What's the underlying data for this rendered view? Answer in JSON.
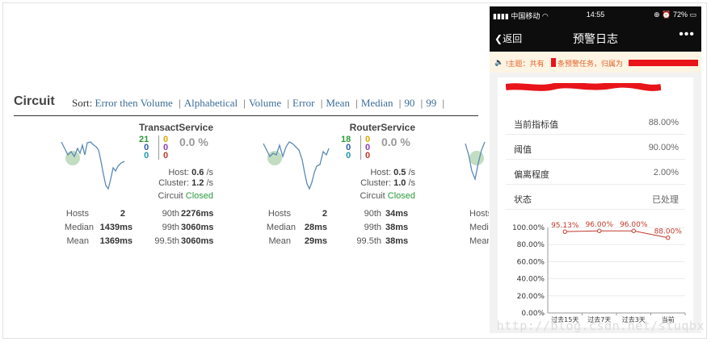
{
  "dashboard": {
    "title": "Circuit",
    "sort_label": "Sort:",
    "sort_options": [
      "Error then Volume",
      "Alphabetical",
      "Volume",
      "Error",
      "Mean",
      "Median",
      "90",
      "99"
    ],
    "cards": [
      {
        "name": "TransactService",
        "counts_left": [
          "21",
          "0",
          "0"
        ],
        "counts_right": [
          "0",
          "0",
          "0"
        ],
        "error_pct": "0.0 %",
        "host_label": "Host:",
        "host_rate": "0.6",
        "host_unit": "/s",
        "cluster_label": "Cluster:",
        "cluster_rate": "1.2",
        "cluster_unit": "/s",
        "circuit_label": "Circuit",
        "circuit_state": "Closed",
        "stats_left": [
          {
            "label": "Hosts",
            "value": "2"
          },
          {
            "label": "Median",
            "value": "1439ms"
          },
          {
            "label": "Mean",
            "value": "1369ms"
          }
        ],
        "stats_right": [
          {
            "label": "90th",
            "value": "2276ms"
          },
          {
            "label": "99th",
            "value": "3060ms"
          },
          {
            "label": "99.5th",
            "value": "3060ms"
          }
        ]
      },
      {
        "name": "RouterService",
        "counts_left": [
          "18",
          "0",
          "0"
        ],
        "counts_right": [
          "0",
          "0",
          "0"
        ],
        "error_pct": "0.0 %",
        "host_label": "Host:",
        "host_rate": "0.5",
        "host_unit": "/s",
        "cluster_label": "Cluster:",
        "cluster_rate": "1.0",
        "cluster_unit": "/s",
        "circuit_label": "Circuit",
        "circuit_state": "Closed",
        "stats_left": [
          {
            "label": "Hosts",
            "value": "2"
          },
          {
            "label": "Median",
            "value": "28ms"
          },
          {
            "label": "Mean",
            "value": "29ms"
          }
        ],
        "stats_right": [
          {
            "label": "90th",
            "value": "34ms"
          },
          {
            "label": "99th",
            "value": "38ms"
          },
          {
            "label": "99.5th",
            "value": "38ms"
          }
        ]
      },
      {
        "name": "",
        "stats_left": [
          {
            "label": "Hosts",
            "value": ""
          },
          {
            "label": "Median",
            "value": ""
          },
          {
            "label": "Mean",
            "value": ""
          }
        ]
      }
    ]
  },
  "phone": {
    "status": {
      "carrier": "中国移动",
      "time": "14:55",
      "battery": "72%"
    },
    "nav": {
      "back": "返回",
      "title": "预警日志",
      "more": "•••"
    },
    "notice": {
      "prefix": "!主题：共有",
      "middle": "条预警任务，归属为"
    },
    "metrics": [
      {
        "label": "当前指标值",
        "value": "88.00%"
      },
      {
        "label": "阈值",
        "value": "90.00%"
      },
      {
        "label": "偏离程度",
        "value": "2.00%"
      },
      {
        "label": "状态",
        "value": "已处理"
      }
    ],
    "chart_data": {
      "type": "line",
      "categories": [
        "过去15天",
        "过去7天",
        "过去3天",
        "当前"
      ],
      "values": [
        95.13,
        96.0,
        96.0,
        88.0
      ],
      "data_labels": [
        "95.13%",
        "96.00%",
        "96.00%",
        "88.00%"
      ],
      "y_ticks": [
        "0.00%",
        "20.00%",
        "40.00%",
        "60.00%",
        "80.00%",
        "100.00%"
      ],
      "ylim": [
        0,
        100
      ],
      "grid": true,
      "color": "#c0392b"
    }
  },
  "watermark": "http://blog.csdn.net/stuqbx"
}
